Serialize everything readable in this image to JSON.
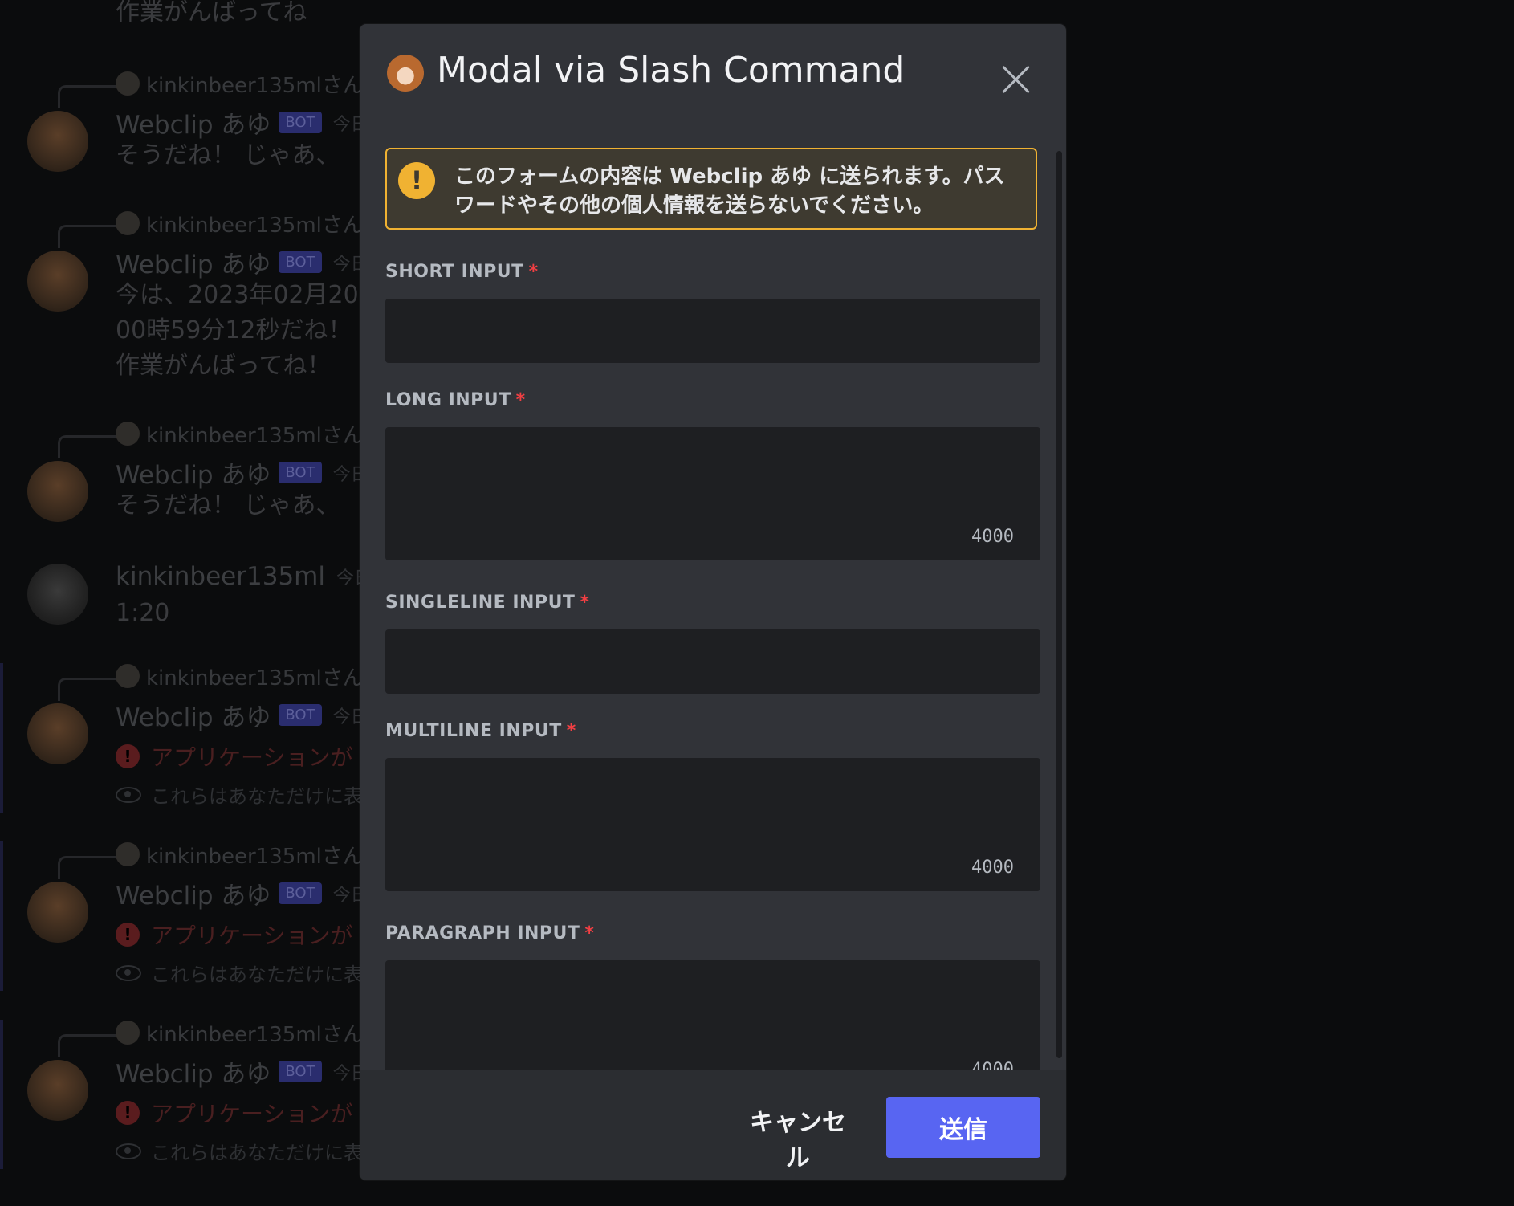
{
  "background_chat": {
    "top_text": "作業がんばってね",
    "messages": [
      {
        "reply_text": "kinkinbeer135mlさん",
        "name": "Webclip あゆ",
        "badge": "BOT",
        "time": "今日",
        "body": "そうだね！ じゃあ、"
      },
      {
        "reply_text": "kinkinbeer135mlさん",
        "name": "Webclip あゆ",
        "badge": "BOT",
        "time": "今日",
        "body": "今は、2023年02月20\n00時59分12秒だね！\n作業がんばってね！"
      },
      {
        "reply_text": "kinkinbeer135mlさん",
        "name": "Webclip あゆ",
        "badge": "BOT",
        "time": "今日",
        "body": "そうだね！ じゃあ、"
      },
      {
        "name": "kinkinbeer135ml",
        "time": "今日",
        "body": "1:20"
      },
      {
        "reply_text": "kinkinbeer135mlさん",
        "name": "Webclip あゆ",
        "badge": "BOT",
        "time": "今日",
        "error": "アプリケーションが",
        "ephemeral": "これらはあなただけに表"
      },
      {
        "reply_text": "kinkinbeer135mlさん",
        "name": "Webclip あゆ",
        "badge": "BOT",
        "time": "今日",
        "error": "アプリケーションが",
        "ephemeral": "これらはあなただけに表"
      },
      {
        "reply_text": "kinkinbeer135mlさん",
        "name": "Webclip あゆ",
        "badge": "BOT",
        "time": "今日",
        "error": "アプリケーションが",
        "ephemeral": "これらはあなただけに表"
      }
    ]
  },
  "modal": {
    "title": "Modal via Slash Command",
    "warning": "このフォームの内容は Webclip あゆ に送られます。パスワードやその他の個人情報を送らないでください。",
    "fields": [
      {
        "label": "SHORT INPUT",
        "required": "*",
        "value": ""
      },
      {
        "label": "LONG INPUT",
        "required": "*",
        "value": "",
        "counter": "4000"
      },
      {
        "label": "SINGLELINE INPUT",
        "required": "*",
        "value": ""
      },
      {
        "label": "MULTILINE INPUT",
        "required": "*",
        "value": "",
        "counter": "4000"
      },
      {
        "label": "PARAGRAPH INPUT",
        "required": "*",
        "value": "",
        "counter": "4000"
      }
    ],
    "cancel_label": "キャンセル",
    "submit_label": "送信"
  },
  "colors": {
    "accent": "#5865f2",
    "warning": "#f0b232",
    "required": "#f23f43",
    "modal_bg": "#313338",
    "input_bg": "#1e1f22"
  }
}
